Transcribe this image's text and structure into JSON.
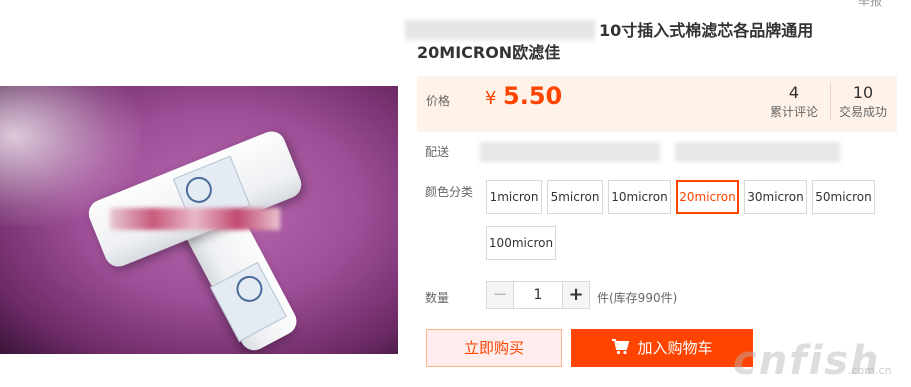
{
  "header": {
    "report_link": "举报"
  },
  "product": {
    "title_line1": "10寸插入式棉滤芯各品牌通用",
    "title_line2": "20MICRON欧滤佳"
  },
  "price": {
    "label": "价格",
    "currency": "¥",
    "value": "5.50",
    "reviews_count": "4",
    "reviews_label": "累计评论",
    "deals_count": "10",
    "deals_label": "交易成功"
  },
  "delivery": {
    "label": "配送"
  },
  "color": {
    "label": "颜色分类",
    "options": [
      "1micron",
      "5micron",
      "10micron",
      "20micron",
      "30micron",
      "50micron",
      "100micron"
    ],
    "selected": "20micron"
  },
  "quantity": {
    "label": "数量",
    "value": "1",
    "stock": "件(库存990件)"
  },
  "actions": {
    "buy_now": "立即购买",
    "add_cart": "加入购物车"
  },
  "watermark": {
    "brand": "cnfish",
    "site": ".com.cn"
  },
  "colors": {
    "accent": "#ff4400",
    "price_bg": "#fff2e8",
    "buy_now_bg": "#ffeded"
  }
}
